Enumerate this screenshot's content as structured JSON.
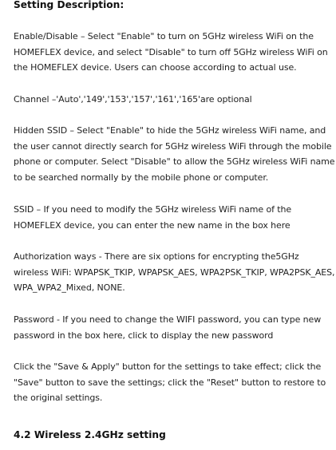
{
  "heading": "Setting Description:",
  "paragraphs": [
    {
      "name": "enable-disable-description",
      "lines": [
        "Enable/Disable – Select \"Enable\" to turn on 5GHz wireless WiFi on the",
        "HOMEFLEX device, and select \"Disable\" to turn off 5GHz wireless WiFi on",
        "the HOMEFLEX device. Users can choose according to actual use."
      ]
    },
    {
      "name": "channel-description",
      "lines": [
        "Channel –'Auto','149','153','157','161','165'are optional"
      ]
    },
    {
      "name": "hidden-ssid-description",
      "lines": [
        "Hidden SSID – Select \"Enable\" to hide the 5GHz wireless WiFi name, and",
        "the user cannot directly search for 5GHz wireless WiFi through the mobile",
        "phone or computer. Select \"Disable\" to allow the 5GHz wireless WiFi name",
        "to be searched normally by the mobile phone or computer."
      ]
    },
    {
      "name": "ssid-description",
      "lines": [
        "SSID  – If you need to modify the 5GHz wireless WiFi name of the",
        "HOMEFLEX device, you can enter the new name in the box here"
      ]
    },
    {
      "name": "authorization-ways-description",
      "lines": [
        "Authorization ways - There are six options for encrypting the5GHz",
        "wireless WiFi: WPAPSK_TKIP, WPAPSK_AES, WPA2PSK_TKIP, WPA2PSK_AES,",
        "WPA_WPA2_Mixed, NONE."
      ]
    },
    {
      "name": "password-description",
      "lines": [
        "Password - If you need to change the WIFI password, you can type new",
        "password in the box here, click to display the new password"
      ]
    },
    {
      "name": "save-apply-description",
      "lines": [
        "Click the \"Save & Apply\" button for the settings to take effect; click the",
        "\"Save\" button to save the settings; click the \"Reset\" button to restore to",
        "the original settings."
      ]
    }
  ],
  "section_heading": "4.2  Wireless 2.4GHz setting"
}
